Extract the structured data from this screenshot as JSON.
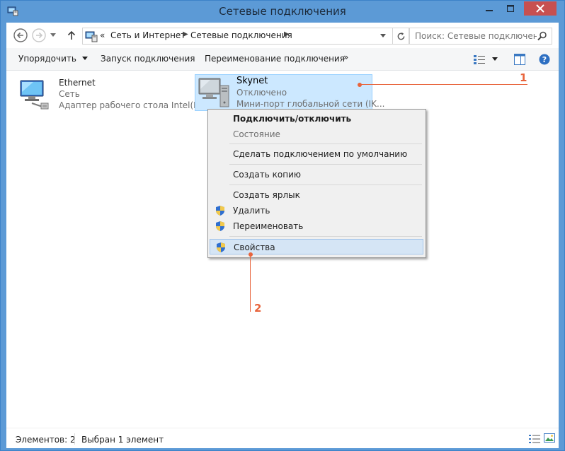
{
  "window": {
    "title": "Сетевые подключения"
  },
  "address": {
    "overflow": "«",
    "crumbs": [
      "Сеть и Интернет",
      "Сетевые подключения"
    ],
    "search_placeholder": "Поиск: Сетевые подключения"
  },
  "toolbar": {
    "organize": "Упорядочить",
    "start": "Запуск подключения",
    "rename": "Переименование подключения",
    "more": "»"
  },
  "connections": [
    {
      "name": "Ethernet",
      "type": "Сеть",
      "adapter": "Адаптер рабочего стола Intel(R) ..."
    },
    {
      "name": "Skynet",
      "status": "Отключено",
      "adapter": "Мини-порт глобальной сети (IK..."
    }
  ],
  "context_menu": {
    "connect": "Подключить/отключить",
    "status": "Состояние",
    "set_default": "Сделать подключением по умолчанию",
    "copy": "Создать копию",
    "shortcut": "Создать ярлык",
    "delete": "Удалить",
    "rename": "Переименовать",
    "properties": "Свойства"
  },
  "annotations": {
    "one": "1",
    "two": "2"
  },
  "statusbar": {
    "items": "Элементов: 2",
    "selected": "Выбран 1 элемент"
  },
  "icons": {
    "back": "back-arrow-icon",
    "forward": "forward-arrow-icon",
    "up": "up-arrow-icon",
    "refresh": "refresh-icon",
    "search": "search-icon",
    "shield": "uac-shield-icon",
    "network": "network-adapter-icon"
  },
  "colors": {
    "accent": "#5c9ad6",
    "selection": "#cce8ff",
    "annotation": "#e8643c",
    "close": "#c75050"
  }
}
